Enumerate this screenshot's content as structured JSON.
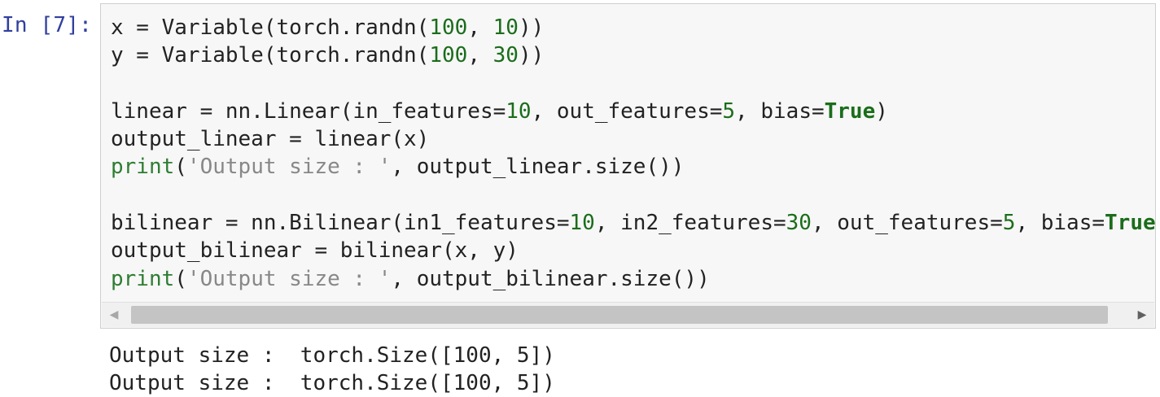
{
  "cell": {
    "prompt": "In [7]:",
    "code_lines": [
      [
        {
          "t": "x = Variable(torch.randn(",
          "c": ""
        },
        {
          "t": "100",
          "c": "num"
        },
        {
          "t": ", ",
          "c": ""
        },
        {
          "t": "10",
          "c": "num"
        },
        {
          "t": "))",
          "c": ""
        }
      ],
      [
        {
          "t": "y = Variable(torch.randn(",
          "c": ""
        },
        {
          "t": "100",
          "c": "num"
        },
        {
          "t": ", ",
          "c": ""
        },
        {
          "t": "30",
          "c": "num"
        },
        {
          "t": "))",
          "c": ""
        }
      ],
      [],
      [
        {
          "t": "linear = nn.Linear(in_features=",
          "c": ""
        },
        {
          "t": "10",
          "c": "num"
        },
        {
          "t": ", out_features=",
          "c": ""
        },
        {
          "t": "5",
          "c": "num"
        },
        {
          "t": ", bias=",
          "c": ""
        },
        {
          "t": "True",
          "c": "bool"
        },
        {
          "t": ")",
          "c": ""
        }
      ],
      [
        {
          "t": "output_linear = linear(x)",
          "c": ""
        }
      ],
      [
        {
          "t": "print",
          "c": "builtin"
        },
        {
          "t": "(",
          "c": ""
        },
        {
          "t": "'Output size : '",
          "c": "str"
        },
        {
          "t": ", output_linear.size())",
          "c": ""
        }
      ],
      [],
      [
        {
          "t": "bilinear = nn.Bilinear(in1_features=",
          "c": ""
        },
        {
          "t": "10",
          "c": "num"
        },
        {
          "t": ", in2_features=",
          "c": ""
        },
        {
          "t": "30",
          "c": "num"
        },
        {
          "t": ", out_features=",
          "c": ""
        },
        {
          "t": "5",
          "c": "num"
        },
        {
          "t": ", bias=",
          "c": ""
        },
        {
          "t": "True",
          "c": "bool"
        },
        {
          "t": ")",
          "c": ""
        }
      ],
      [
        {
          "t": "output_bilinear = bilinear(x, y)",
          "c": ""
        }
      ],
      [
        {
          "t": "print",
          "c": "builtin"
        },
        {
          "t": "(",
          "c": ""
        },
        {
          "t": "'Output size : '",
          "c": "str"
        },
        {
          "t": ", output_bilinear.size())",
          "c": ""
        }
      ]
    ],
    "scrollbar": {
      "left_arrow_icon": "chevron-left-icon",
      "right_arrow_icon": "chevron-right-icon"
    }
  },
  "output": {
    "lines": [
      "Output size :  torch.Size([100, 5])",
      "Output size :  torch.Size([100, 5])"
    ]
  }
}
